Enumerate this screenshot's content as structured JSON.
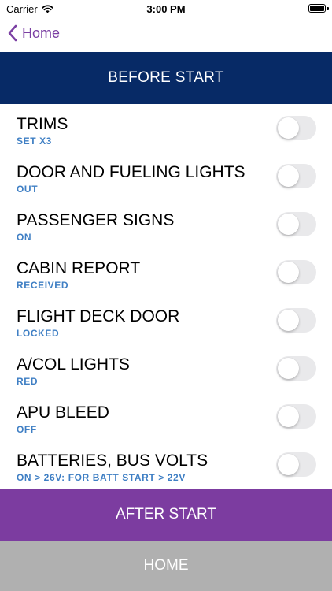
{
  "status_bar": {
    "carrier": "Carrier",
    "time": "3:00 PM"
  },
  "nav": {
    "back_label": "Home"
  },
  "header": {
    "title": "BEFORE START"
  },
  "checklist": {
    "items": [
      {
        "title": "TRIMS",
        "subtitle": "SET X3",
        "checked": false
      },
      {
        "title": "DOOR AND FUELING LIGHTS",
        "subtitle": "OUT",
        "checked": false
      },
      {
        "title": "PASSENGER SIGNS",
        "subtitle": "ON",
        "checked": false
      },
      {
        "title": "CABIN REPORT",
        "subtitle": "RECEIVED",
        "checked": false
      },
      {
        "title": "FLIGHT DECK DOOR",
        "subtitle": "LOCKED",
        "checked": false
      },
      {
        "title": "A/COL LIGHTS",
        "subtitle": "RED",
        "checked": false
      },
      {
        "title": "APU BLEED",
        "subtitle": "OFF",
        "checked": false
      },
      {
        "title": "BATTERIES, BUS VOLTS",
        "subtitle": "ON > 26V: FOR BATT START > 22V",
        "checked": false
      }
    ]
  },
  "footer": {
    "next_label": "AFTER START",
    "home_label": "HOME"
  },
  "colors": {
    "header_bg": "#072a66",
    "accent_purple": "#7c3ca0",
    "subtitle_blue": "#3f7fc4",
    "home_gray": "#b0b0b0"
  }
}
